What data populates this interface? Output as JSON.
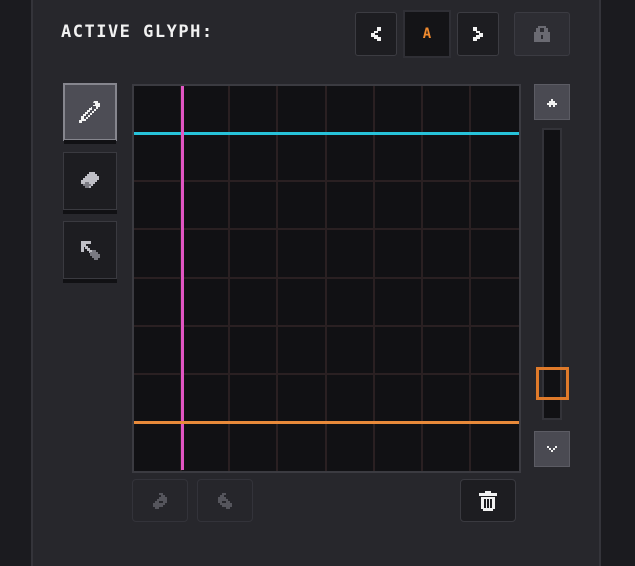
{
  "header": {
    "title": "ACTIVE GLYPH:",
    "active_glyph": "A"
  },
  "icons": {
    "prev": "chevron-left-icon",
    "next": "chevron-right-icon",
    "lock": "lock-icon",
    "pencil": "pencil-icon",
    "eraser": "eraser-icon",
    "fill": "fill-icon",
    "scroll_up": "chevron-up-icon",
    "scroll_down": "chevron-down-icon",
    "undo": "undo-icon",
    "redo": "redo-icon",
    "trash": "trash-icon"
  },
  "tools": {
    "active": "pencil"
  },
  "canvas": {
    "grid_columns": 8,
    "grid_rows": 8
  },
  "scrollbar": {
    "position_fraction": 0.93
  },
  "colors": {
    "accent": "#df7a2a",
    "guide_top": "#27c3da",
    "guide_left": "#e255c3",
    "guide_baseline": "#e88a3a",
    "panel": "#27272c",
    "background": "#1b1b1f"
  }
}
